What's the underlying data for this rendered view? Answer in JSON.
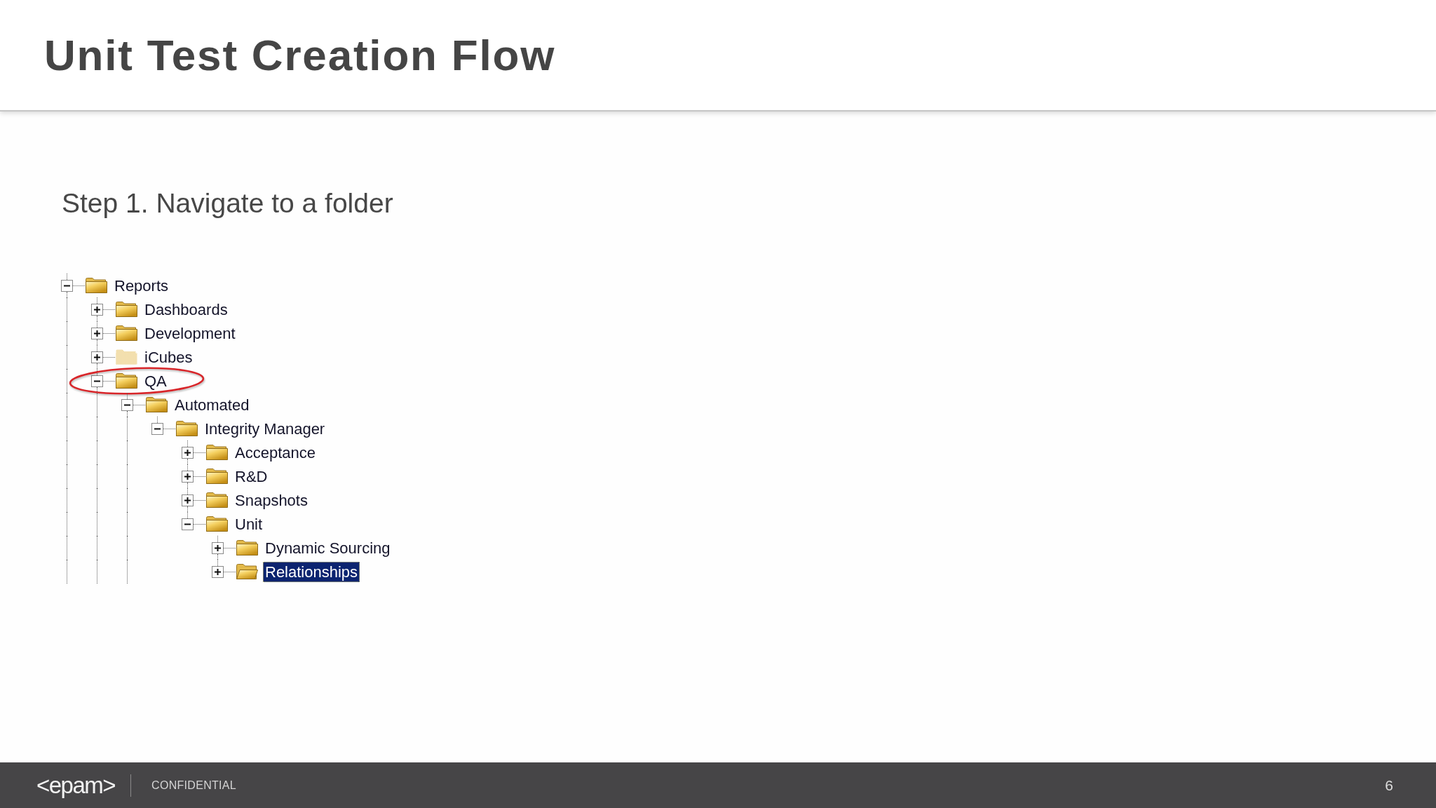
{
  "header": {
    "title": "Unit Test Creation Flow"
  },
  "step": {
    "text": "Step 1. Navigate to a folder"
  },
  "tree": {
    "items": [
      {
        "label": "Reports",
        "kind": "folder",
        "expanded": true,
        "selected": false,
        "circled": false,
        "continues": true,
        "children": [
          {
            "label": "Dashboards",
            "kind": "folder",
            "expanded": false,
            "selected": false,
            "circled": false
          },
          {
            "label": "Development",
            "kind": "folder",
            "expanded": false,
            "selected": false,
            "circled": false
          },
          {
            "label": "iCubes",
            "kind": "ghost",
            "expanded": false,
            "selected": false,
            "circled": false
          },
          {
            "label": "QA",
            "kind": "folder",
            "expanded": true,
            "selected": false,
            "circled": true,
            "continues": true,
            "children": [
              {
                "label": "Automated",
                "kind": "folder",
                "expanded": true,
                "selected": false,
                "circled": false,
                "continues": true,
                "children": [
                  {
                    "label": "Integrity Manager",
                    "kind": "folder",
                    "expanded": true,
                    "selected": false,
                    "circled": false,
                    "continues": false,
                    "children": [
                      {
                        "label": "Acceptance",
                        "kind": "folder",
                        "expanded": false,
                        "selected": false,
                        "circled": false
                      },
                      {
                        "label": "R&D",
                        "kind": "folder",
                        "expanded": false,
                        "selected": false,
                        "circled": false
                      },
                      {
                        "label": "Snapshots",
                        "kind": "folder",
                        "expanded": false,
                        "selected": false,
                        "circled": false
                      },
                      {
                        "label": "Unit",
                        "kind": "folder",
                        "expanded": true,
                        "selected": false,
                        "circled": false,
                        "continues": false,
                        "children": [
                          {
                            "label": "Dynamic Sourcing",
                            "kind": "folder",
                            "expanded": false,
                            "selected": false,
                            "circled": false
                          },
                          {
                            "label": "Relationships",
                            "kind": "folder",
                            "expanded": false,
                            "selected": true,
                            "circled": false,
                            "continues": false
                          }
                        ]
                      }
                    ]
                  }
                ]
              }
            ]
          }
        ]
      }
    ]
  },
  "footer": {
    "logo": "<epam>",
    "label": "CONFIDENTIAL",
    "page": "6"
  }
}
